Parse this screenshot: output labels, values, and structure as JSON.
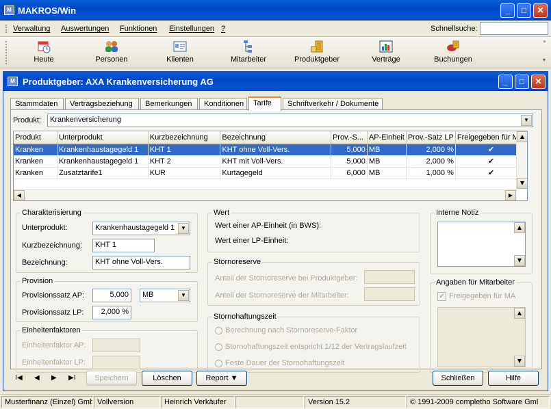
{
  "app": {
    "title": "MAKROS/Win"
  },
  "menu": {
    "items": [
      "Verwaltung",
      "Auswertungen",
      "Funktionen",
      "Einstellungen",
      "?"
    ],
    "quicksearch_label": "Schnellsuche:",
    "quicksearch_value": ""
  },
  "toolbar": {
    "buttons": [
      {
        "label": "Heute",
        "icon": "calendar-clock-icon"
      },
      {
        "label": "Personen",
        "icon": "people-icon"
      },
      {
        "label": "Klienten",
        "icon": "id-card-icon"
      },
      {
        "label": "Mitarbeiter",
        "icon": "org-chart-icon"
      },
      {
        "label": "Produktgeber",
        "icon": "building-icon"
      },
      {
        "label": "Verträge",
        "icon": "contract-chart-icon"
      },
      {
        "label": "Buchungen",
        "icon": "bookings-icon"
      }
    ]
  },
  "child": {
    "title": "Produktgeber: AXA Krankenversicherung AG"
  },
  "tabs": [
    "Stammdaten",
    "Vertragsbeziehung",
    "Bemerkungen",
    "Konditionen",
    "Tarife",
    "Schriftverkehr / Dokumente"
  ],
  "active_tab": "Tarife",
  "product": {
    "label": "Produkt:",
    "value": "Krankenversicherung"
  },
  "grid": {
    "columns": [
      "Produkt",
      "Unterprodukt",
      "Kurzbezeichnung",
      "Bezeichnung",
      "Prov.-S...",
      "AP-Einheit",
      "Prov.-Satz LP",
      "Freigegeben für M..."
    ],
    "rows": [
      {
        "produkt": "Kranken",
        "unterprodukt": "Krankenhaustagegeld 1",
        "kurz": "KHT 1",
        "bez": "KHT ohne Voll-Vers.",
        "prov": "5,000",
        "ap": "MB",
        "lp": "2,000 %",
        "frei": "✔",
        "selected": true
      },
      {
        "produkt": "Kranken",
        "unterprodukt": "Krankenhaustagegeld 1",
        "kurz": "KHT 2",
        "bez": "KHT mit Voll-Vers.",
        "prov": "5,000",
        "ap": "MB",
        "lp": "2,000 %",
        "frei": "✔",
        "selected": false
      },
      {
        "produkt": "Kranken",
        "unterprodukt": "Zusatztarife1",
        "kurz": "KUR",
        "bez": "Kurtagegeld",
        "prov": "6,000",
        "ap": "MB",
        "lp": "1,000 %",
        "frei": "✔",
        "selected": false
      }
    ]
  },
  "charakterisierung": {
    "title": "Charakterisierung",
    "unterprodukt_label": "Unterprodukt:",
    "unterprodukt_value": "Krankenhaustagegeld 1",
    "kurz_label": "Kurzbezeichnung:",
    "kurz_value": "KHT 1",
    "bez_label": "Bezeichnung:",
    "bez_value": "KHT ohne Voll-Vers."
  },
  "provision": {
    "title": "Provision",
    "ap_label": "Provisionssatz AP:",
    "ap_value": "5,000",
    "ap_unit": "MB",
    "lp_label": "Provisionssatz LP:",
    "lp_value": "2,000 %"
  },
  "einheiten": {
    "title": "Einheitenfaktoren",
    "ap_label": "Einheitenfaktor AP:",
    "lp_label": "Einheitenfaktor LP:"
  },
  "wert": {
    "title": "Wert",
    "ap_label": "Wert einer AP-Einheit (in BWS):",
    "lp_label": "Wert einer LP-Einheit:"
  },
  "storno": {
    "title": "Stornoreserve",
    "pg_label": "Anteil der Stornoreserve bei Produktgeber:",
    "ma_label": "Anteil der Stornoreserve der Mitarbeiter:"
  },
  "haftung": {
    "title": "Stornohaftungszeit",
    "opt1": "Berechnung nach Stornoreserve-Faktor",
    "opt2": "Stornohaftungszeit entspricht 1/12 der Vertragslaufzeit",
    "opt3": "Feste Dauer der Stornohaftungszeit"
  },
  "notiz": {
    "title": "Interne Notiz"
  },
  "mitarbeiter": {
    "title": "Angaben für Mitarbeiter",
    "freigabe_label": "Freigegeben für MA",
    "freigabe_checked": true
  },
  "buttons": {
    "speichern": "Speichern",
    "loeschen": "Löschen",
    "report": "Report",
    "schliessen": "Schließen",
    "hilfe": "Hilfe"
  },
  "nav": {
    "first": "I◀",
    "prev": "◀",
    "next": "▶",
    "last": "▶I"
  },
  "status": [
    "Musterfinanz (Einzel) Gmb",
    "Vollversion",
    "Heinrich Verkäufer",
    "",
    "Version 15.2",
    "© 1991-2009 completho Software Gml"
  ]
}
